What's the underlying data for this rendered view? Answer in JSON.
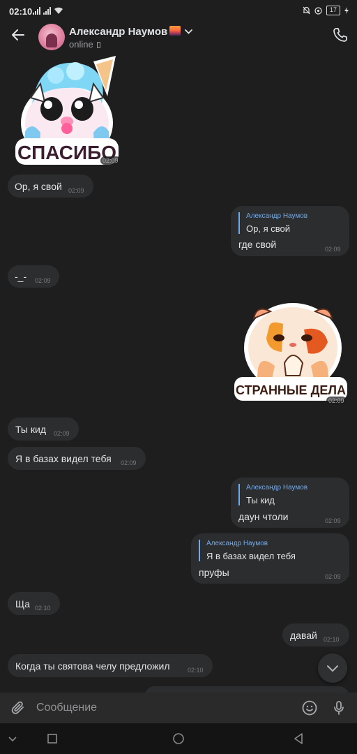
{
  "status_bar": {
    "time": "02:10",
    "battery": "17"
  },
  "header": {
    "contact_name": "Александр Наумов",
    "status": "online",
    "avatar_icon": "avatar",
    "call_icon": "phone-icon",
    "back_icon": "back-arrow-icon"
  },
  "messages": [
    {
      "type": "sticker",
      "side": "in",
      "caption": "СПАСИБО",
      "time": "02:09"
    },
    {
      "type": "text",
      "side": "in",
      "text": "Ор, я свой",
      "time": "02:09"
    },
    {
      "type": "reply",
      "side": "out",
      "reply_name": "Александр Наумов",
      "reply_text": "Ор, я свой",
      "text": "где свой",
      "time": "02:09"
    },
    {
      "type": "text",
      "side": "in",
      "text": "-_-",
      "time": "02:09"
    },
    {
      "type": "sticker",
      "side": "out",
      "caption": "СТРАННЫЕ ДЕЛА",
      "time": "02:09"
    },
    {
      "type": "text",
      "side": "in",
      "text": "Ты кид",
      "time": "02:09"
    },
    {
      "type": "text",
      "side": "in",
      "text": "Я в базах видел тебя",
      "time": "02:09"
    },
    {
      "type": "reply",
      "side": "out",
      "reply_name": "Александр Наумов",
      "reply_text": "Ты кид",
      "text": "даун чтоли",
      "time": "02:09"
    },
    {
      "type": "reply",
      "side": "out",
      "reply_name": "Александр Наумов",
      "reply_text": "Я в базах видел тебя",
      "text": "пруфы",
      "time": "02:09"
    },
    {
      "type": "text",
      "side": "in",
      "text": "Ща",
      "time": "02:10"
    },
    {
      "type": "text",
      "side": "out",
      "text": "давай",
      "time": "02:10"
    },
    {
      "type": "text",
      "side": "in",
      "text": "Когда ты святова челу предложил",
      "time": "02:10"
    }
  ],
  "composer": {
    "placeholder": "Сообщение"
  },
  "colors": {
    "background": "#1e1e1f",
    "bubble": "#2c2d2e",
    "accent": "#71aaeb",
    "text": "#e1e3e6",
    "muted": "#76787a"
  }
}
